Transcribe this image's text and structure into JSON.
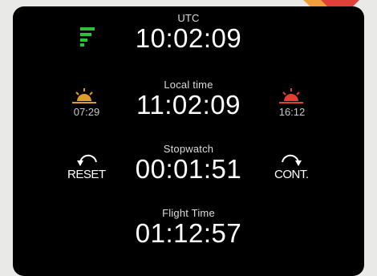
{
  "clock": {
    "utc_label": "UTC",
    "utc_time": "10:02:09",
    "local_label": "Local time",
    "local_time": "11:02:09",
    "stopwatch_label": "Stopwatch",
    "stopwatch_time": "00:01:51",
    "flight_label": "Flight Time",
    "flight_time": "01:12:57"
  },
  "sun": {
    "sunrise_time": "07:29",
    "sunset_time": "16:12"
  },
  "controls": {
    "reset_label": "RESET",
    "continue_label": "CONT."
  },
  "icons": {
    "gps": "signal-bars-icon",
    "sunrise": "sunrise-icon",
    "sunset": "sunset-icon",
    "reset": "reset-arrow-icon",
    "continue": "continue-arrow-icon"
  },
  "colors": {
    "background": "#000000",
    "gps_green": "#2fbf3a",
    "sunrise_orange": "#e09a2c",
    "sunset_red": "#e0402c",
    "corner_accent": "#e0403a"
  }
}
